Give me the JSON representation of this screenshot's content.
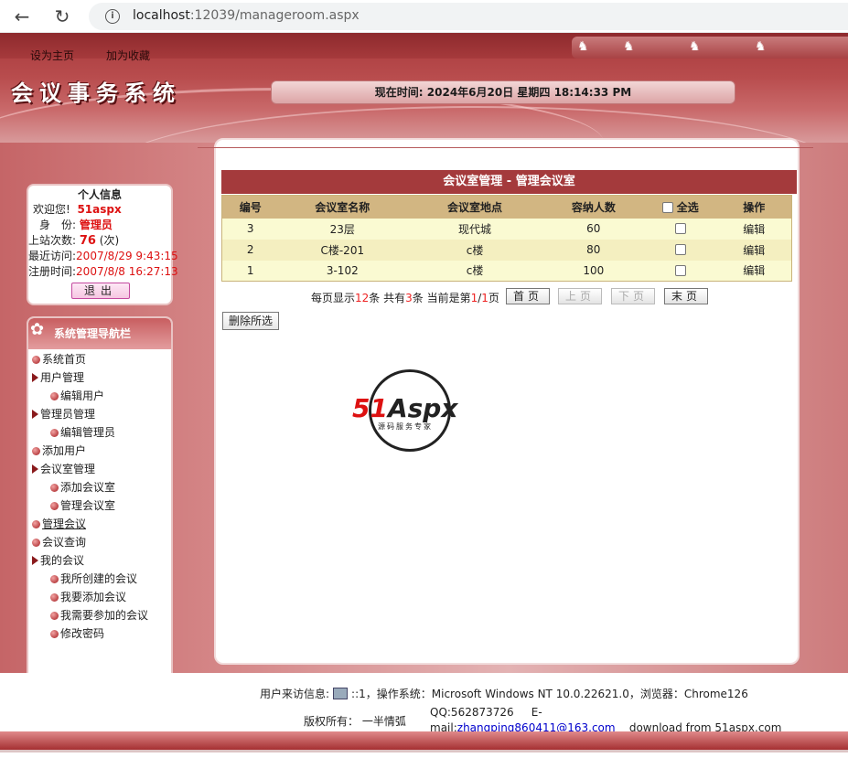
{
  "browser": {
    "url_host": "localhost",
    "url_rest": ":12039/manageroom.aspx"
  },
  "header": {
    "set_home": "设为主页",
    "add_favorite": "加为收藏",
    "site_title": "会议事务系统",
    "time_label": "现在时间: ",
    "time_value": "2024年6月20日 星期四 18:14:33 PM"
  },
  "user_panel": {
    "title": "个人信息",
    "welcome_label": "欢迎您!",
    "username": "51aspx",
    "role_label": "身　份:",
    "role": "管理员",
    "visits_label": "上站次数:",
    "visits": "76",
    "visits_unit": "(次)",
    "last_visit_label": "最近访问:",
    "last_visit": "2007/8/29 9:43:15",
    "register_label": "注册时间:",
    "register_time": "2007/8/8 16:27:13",
    "logout": "退出"
  },
  "nav": {
    "title": "系统管理导航栏",
    "items": [
      {
        "label": "系统首页"
      },
      {
        "label": "用户管理"
      },
      {
        "label": "编辑用户"
      },
      {
        "label": "管理员管理"
      },
      {
        "label": "编辑管理员"
      },
      {
        "label": "添加用户"
      },
      {
        "label": "会议室管理"
      },
      {
        "label": "添加会议室"
      },
      {
        "label": "管理会议室"
      },
      {
        "label": "管理会议"
      },
      {
        "label": "会议查询"
      },
      {
        "label": "我的会议"
      },
      {
        "label": "我所创建的会议"
      },
      {
        "label": "我要添加会议"
      },
      {
        "label": "我需要参加的会议"
      },
      {
        "label": "修改密码"
      }
    ]
  },
  "main": {
    "title": "会议室管理 - 管理会议室",
    "columns": [
      "编号",
      "会议室名称",
      "会议室地点",
      "容纳人数",
      "全选",
      "操作"
    ],
    "rows": [
      {
        "id": "3",
        "name": "23层",
        "location": "现代城",
        "capacity": "60",
        "action": "编辑"
      },
      {
        "id": "2",
        "name": "C楼-201",
        "location": "c楼",
        "capacity": "80",
        "action": "编辑"
      },
      {
        "id": "1",
        "name": "3-102",
        "location": "c楼",
        "capacity": "100",
        "action": "编辑"
      }
    ],
    "pager": {
      "p1": "每页显示",
      "per_page": "12",
      "p2": "条 共有",
      "total": "3",
      "p3": "条 当前是第",
      "current": "1",
      "slash": "/",
      "pages": "1",
      "p4": "页",
      "first": "首页",
      "prev": "上页",
      "next": "下页",
      "last": "末页"
    },
    "delete_selected": "删除所选"
  },
  "watermark": {
    "text_red": "51",
    "text_dark": "Aspx",
    "sub": "源码服务专家"
  },
  "footer": {
    "visitor_label": "用户来访信息:",
    "visitor_info": "::1，操作系统：Microsoft Windows NT 10.0.22621.0，浏览器：Chrome126",
    "copyright": "版权所有：  一半情弧",
    "qq": "QQ:562873726",
    "email_label": "E-mail:",
    "email": "zhangping860411@163.com",
    "download": "download from 51aspx.com"
  }
}
